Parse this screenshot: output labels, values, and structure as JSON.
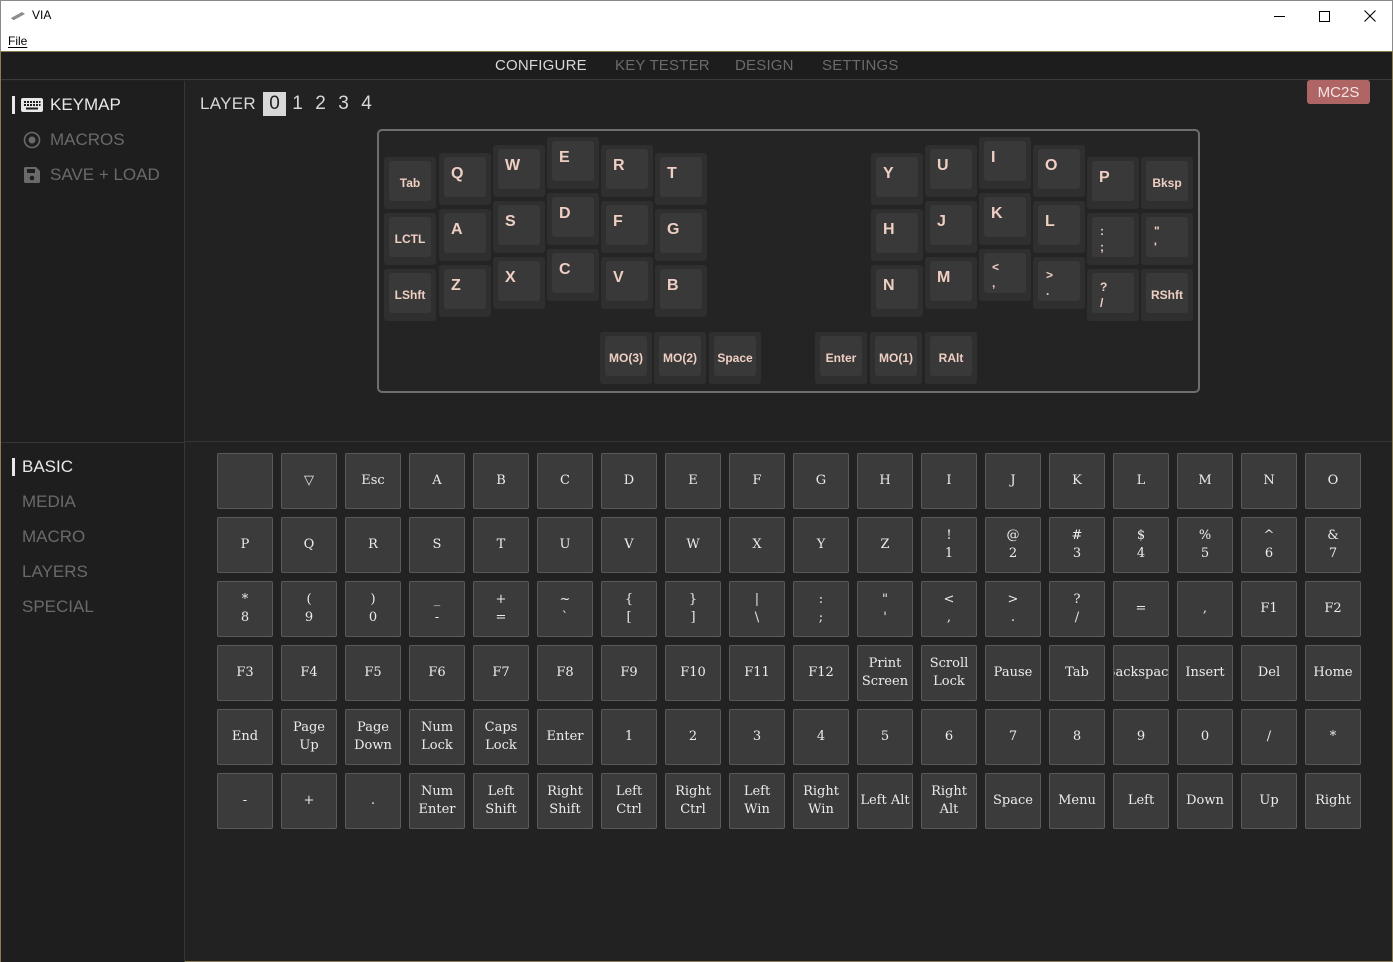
{
  "window": {
    "title": "VIA",
    "menu_file": "File"
  },
  "nav": {
    "tabs": [
      {
        "label": "CONFIGURE",
        "active": true
      },
      {
        "label": "KEY TESTER",
        "active": false
      },
      {
        "label": "DESIGN",
        "active": false
      },
      {
        "label": "SETTINGS",
        "active": false
      }
    ]
  },
  "sidebar": {
    "items": [
      {
        "label": "KEYMAP",
        "icon": "keyboard-icon",
        "active": true
      },
      {
        "label": "MACROS",
        "icon": "record-icon",
        "active": false
      },
      {
        "label": "SAVE + LOAD",
        "icon": "floppy-disk-icon",
        "active": false
      }
    ]
  },
  "layers": {
    "label": "LAYER",
    "numbers": [
      "0",
      "1",
      "2",
      "3",
      "4"
    ],
    "active": "0"
  },
  "device_badge": "MC2S",
  "keyboard": {
    "keys": [
      {
        "label": "Tab"
      },
      {
        "label": "Q"
      },
      {
        "label": "W"
      },
      {
        "label": "E"
      },
      {
        "label": "R"
      },
      {
        "label": "T"
      },
      {
        "label": "Y"
      },
      {
        "label": "U"
      },
      {
        "label": "I"
      },
      {
        "label": "O"
      },
      {
        "label": "P"
      },
      {
        "label": "Bksp"
      },
      {
        "label": "LCTL"
      },
      {
        "label": "A"
      },
      {
        "label": "S"
      },
      {
        "label": "D"
      },
      {
        "label": "F"
      },
      {
        "label": "G"
      },
      {
        "label": "H"
      },
      {
        "label": "J"
      },
      {
        "label": "K"
      },
      {
        "label": "L"
      },
      {
        "label": ":\n;"
      },
      {
        "label": "\"\n'"
      },
      {
        "label": "LShft"
      },
      {
        "label": "Z"
      },
      {
        "label": "X"
      },
      {
        "label": "C"
      },
      {
        "label": "V"
      },
      {
        "label": "B"
      },
      {
        "label": "N"
      },
      {
        "label": "M"
      },
      {
        "label": "<\n,"
      },
      {
        "label": ">\n."
      },
      {
        "label": "?\n/"
      },
      {
        "label": "RShft"
      },
      {
        "label": "MO(3)"
      },
      {
        "label": "MO(2)"
      },
      {
        "label": "Space"
      },
      {
        "label": "Enter"
      },
      {
        "label": "MO(1)"
      },
      {
        "label": "RAlt"
      }
    ]
  },
  "categories": {
    "items": [
      {
        "label": "BASIC",
        "active": true
      },
      {
        "label": "MEDIA",
        "active": false
      },
      {
        "label": "MACRO",
        "active": false
      },
      {
        "label": "LAYERS",
        "active": false
      },
      {
        "label": "SPECIAL",
        "active": false
      }
    ]
  },
  "keycodes": [
    "",
    "▽",
    "Esc",
    "A",
    "B",
    "C",
    "D",
    "E",
    "F",
    "G",
    "H",
    "I",
    "J",
    "K",
    "L",
    "M",
    "N",
    "O",
    "P",
    "Q",
    "R",
    "S",
    "T",
    "U",
    "V",
    "W",
    "X",
    "Y",
    "Z",
    "!\n1",
    "@\n2",
    "#\n3",
    "$\n4",
    "%\n5",
    "^\n6",
    "&\n7",
    "*\n8",
    "(\n9",
    ")\n0",
    "_\n-",
    "+\n=",
    "~\n`",
    "{\n[",
    "}\n]",
    "|\n\\",
    ":\n;",
    "\"\n'",
    "<\n,",
    ">\n.",
    "?\n/",
    "=",
    ",",
    "F1",
    "F2",
    "F3",
    "F4",
    "F5",
    "F6",
    "F7",
    "F8",
    "F9",
    "F10",
    "F11",
    "F12",
    "Print\nScreen",
    "Scroll\nLock",
    "Pause",
    "Tab",
    "Backspace",
    "Insert",
    "Del",
    "Home",
    "End",
    "Page Up",
    "Page\nDown",
    "Num\nLock",
    "Caps\nLock",
    "Enter",
    "1",
    "2",
    "3",
    "4",
    "5",
    "6",
    "7",
    "8",
    "9",
    "0",
    "/",
    "*",
    "-",
    "+",
    ".",
    "Num\nEnter",
    "Left\nShift",
    "Right\nShift",
    "Left Ctrl",
    "Right\nCtrl",
    "Left Win",
    "Right\nWin",
    "Left Alt",
    "Right Alt",
    "Space",
    "Menu",
    "Left",
    "Down",
    "Up",
    "Right"
  ],
  "colors": {
    "accent_badge": "#b06565",
    "legend": "#efcfc3",
    "frame": "#8b7b53"
  }
}
